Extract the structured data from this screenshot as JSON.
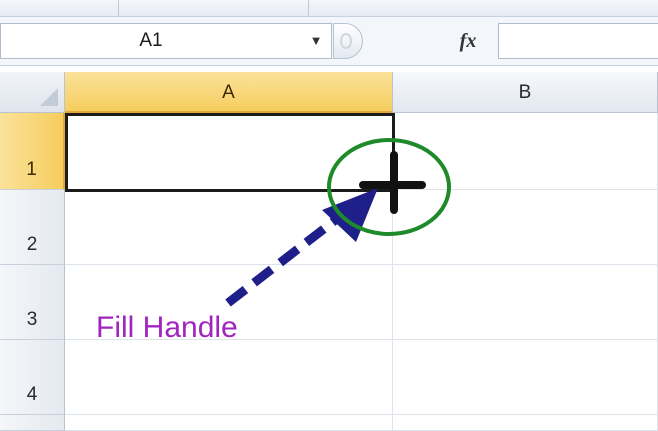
{
  "formula_bar": {
    "name_box_value": "A1",
    "name_box_dropdown_icon": "caret-down-icon",
    "function_button_icon": "fx-icon",
    "function_label": "fx",
    "formula_value": ""
  },
  "grid": {
    "columns": [
      {
        "label": "A",
        "active": true
      },
      {
        "label": "B",
        "active": false
      }
    ],
    "rows": [
      {
        "label": "1",
        "active": true
      },
      {
        "label": "2",
        "active": false
      },
      {
        "label": "3",
        "active": false
      },
      {
        "label": "4",
        "active": false
      }
    ],
    "selected_cell": "A1"
  },
  "annotation": {
    "label": "Fill Handle",
    "label_color": "#a224c0",
    "arrow_color": "#1f1f8a",
    "circle_color": "#1f8a2a"
  },
  "colors": {
    "active_header": "#f6cd5e",
    "selection_border": "#1b1b1b"
  }
}
